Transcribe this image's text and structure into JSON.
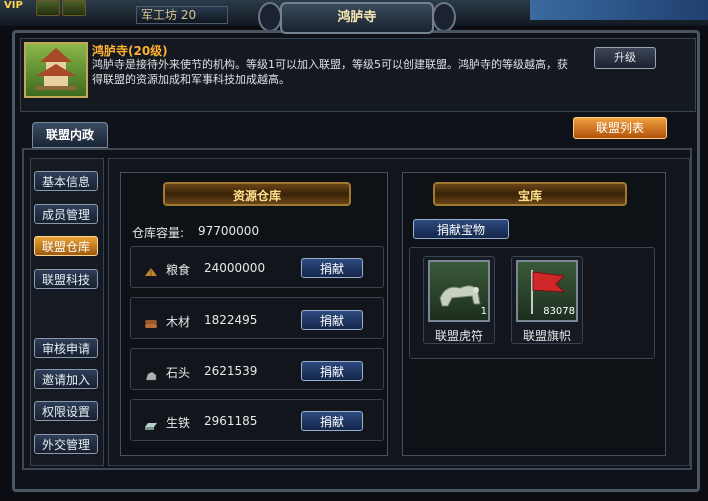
{
  "top": {
    "vip": "VIP",
    "barracks": "军工坊 20",
    "title": "鸿胪寺"
  },
  "building": {
    "title": "鸿胪寺(20级)",
    "description": "鸿胪寺是接待外来使节的机构。等级1可以加入联盟，等级5可以创建联盟。鸿胪寺的等级越高，获得联盟的资源加成和军事科技加成越高。",
    "upgrade_label": "升级"
  },
  "tab_label": "联盟内政",
  "alliance_list_label": "联盟列表",
  "sidebar": {
    "items": [
      {
        "label": "基本信息",
        "active": false
      },
      {
        "label": "成员管理",
        "active": false
      },
      {
        "label": "联盟仓库",
        "active": true
      },
      {
        "label": "联盟科技",
        "active": false
      },
      {
        "label": "审核申请",
        "active": false
      },
      {
        "label": "邀请加入",
        "active": false
      },
      {
        "label": "权限设置",
        "active": false
      },
      {
        "label": "外交管理",
        "active": false
      }
    ]
  },
  "warehouse": {
    "title": "资源仓库",
    "capacity_label": "仓库容量:",
    "capacity_value": "97700000",
    "resources": [
      {
        "icon": "grain-icon",
        "name": "粮食",
        "value": "24000000",
        "button": "捐献",
        "color": "#c08a30"
      },
      {
        "icon": "wood-icon",
        "name": "木材",
        "value": "1822495",
        "button": "捐献",
        "color": "#9a5a2a"
      },
      {
        "icon": "stone-icon",
        "name": "石头",
        "value": "2621539",
        "button": "捐献",
        "color": "#b0b0b0"
      },
      {
        "icon": "iron-icon",
        "name": "生铁",
        "value": "2961185",
        "button": "捐献",
        "color": "#8aa8a0"
      }
    ]
  },
  "treasury": {
    "title": "宝库",
    "donate_label": "捐献宝物",
    "items": [
      {
        "icon": "tiger-tally-icon",
        "name": "联盟虎符",
        "count": "1"
      },
      {
        "icon": "alliance-flag-icon",
        "name": "联盟旗帜",
        "count": "83078"
      }
    ]
  }
}
